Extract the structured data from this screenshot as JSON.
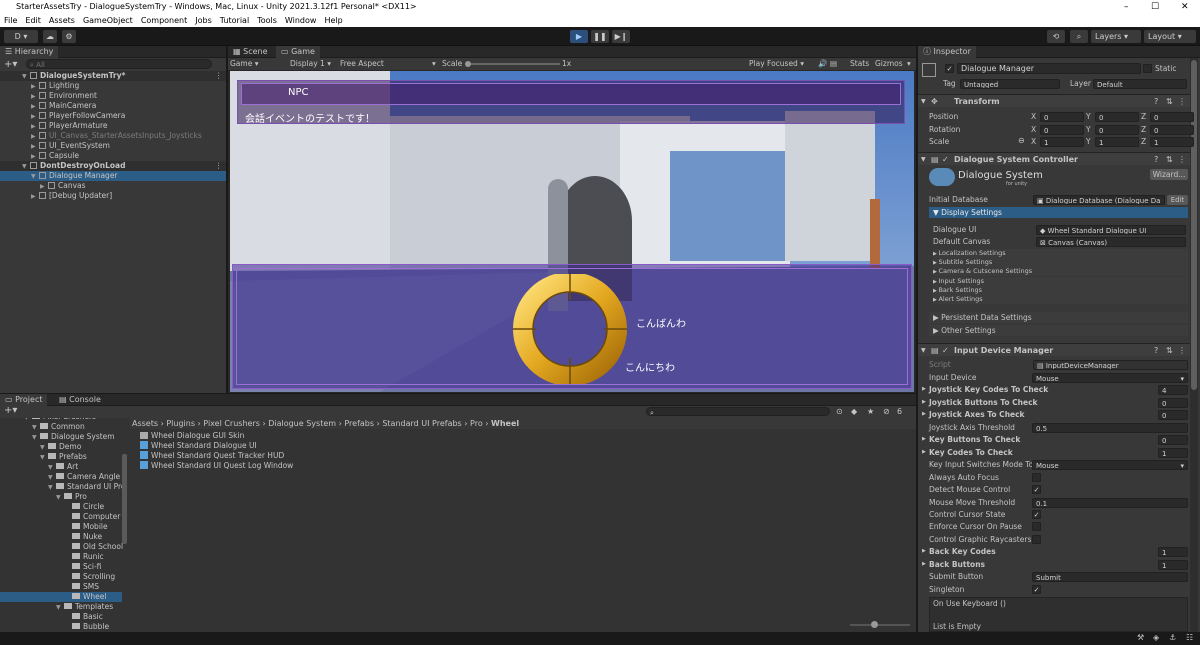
{
  "window": {
    "title": "StarterAssetsTry - DialogueSystemTry - Windows, Mac, Linux - Unity 2021.3.12f1 Personal* <DX11>",
    "minimize": "–",
    "maximize": "☐",
    "close": "✕"
  },
  "menu": [
    "File",
    "Edit",
    "Assets",
    "GameObject",
    "Component",
    "Jobs",
    "Tutorial",
    "Tools",
    "Window",
    "Help"
  ],
  "toolbar": {
    "account": "D ▾",
    "layers": "Layers",
    "layout": "Layout"
  },
  "hierarchy": {
    "tab": "Hierarchy",
    "search_placeholder": "All",
    "items": [
      {
        "label": "DialogueSystemTry*",
        "indent": 0,
        "kind": "scene"
      },
      {
        "label": "Lighting",
        "indent": 1,
        "kind": "obj"
      },
      {
        "label": "Environment",
        "indent": 1,
        "kind": "obj"
      },
      {
        "label": "MainCamera",
        "indent": 1,
        "kind": "obj"
      },
      {
        "label": "PlayerFollowCamera",
        "indent": 1,
        "kind": "obj"
      },
      {
        "label": "PlayerArmature",
        "indent": 1,
        "kind": "obj"
      },
      {
        "label": "UI_Canvas_StarterAssetsInputs_Joysticks",
        "indent": 1,
        "kind": "obj",
        "dim": true
      },
      {
        "label": "UI_EventSystem",
        "indent": 1,
        "kind": "obj"
      },
      {
        "label": "Capsule",
        "indent": 1,
        "kind": "obj"
      },
      {
        "label": "DontDestroyOnLoad",
        "indent": 0,
        "kind": "scene"
      },
      {
        "label": "Dialogue Manager",
        "indent": 1,
        "kind": "obj",
        "selected": true
      },
      {
        "label": "Canvas",
        "indent": 2,
        "kind": "obj"
      },
      {
        "label": "[Debug Updater]",
        "indent": 1,
        "kind": "obj"
      }
    ]
  },
  "scene_game": {
    "tabs": [
      "Scene",
      "Game"
    ],
    "game_label": "Game",
    "display": "Display 1",
    "aspect": "Free Aspect",
    "scale_label": "Scale",
    "scale_value": "1x",
    "play_focused": "Play Focused",
    "stats": "Stats",
    "gizmos": "Gizmos",
    "npc_name": "NPC",
    "npc_line": "会話イベントのテストです！",
    "response_1": "こんばんわ",
    "response_2": "こんにちわ"
  },
  "project": {
    "tabs": [
      "Project",
      "Console"
    ],
    "breadcrumb": [
      "Assets",
      "Plugins",
      "Pixel Crushers",
      "Dialogue System",
      "Prefabs",
      "Standard UI Prefabs",
      "Pro",
      "Wheel"
    ],
    "tree": [
      {
        "label": "Pixel Crushers",
        "indent": 0
      },
      {
        "label": "Common",
        "indent": 1
      },
      {
        "label": "Dialogue System",
        "indent": 1
      },
      {
        "label": "Demo",
        "indent": 2
      },
      {
        "label": "Prefabs",
        "indent": 2
      },
      {
        "label": "Art",
        "indent": 3
      },
      {
        "label": "Camera Angle S",
        "indent": 3
      },
      {
        "label": "Standard UI Pre",
        "indent": 3
      },
      {
        "label": "Pro",
        "indent": 4
      },
      {
        "label": "Circle",
        "indent": 5
      },
      {
        "label": "Computer",
        "indent": 5
      },
      {
        "label": "Mobile",
        "indent": 5
      },
      {
        "label": "Nuke",
        "indent": 5
      },
      {
        "label": "Old School",
        "indent": 5
      },
      {
        "label": "Runic",
        "indent": 5
      },
      {
        "label": "Sci-fi",
        "indent": 5
      },
      {
        "label": "Scrolling",
        "indent": 5
      },
      {
        "label": "SMS",
        "indent": 5
      },
      {
        "label": "Wheel",
        "indent": 5,
        "selected": true
      },
      {
        "label": "Templates",
        "indent": 4
      },
      {
        "label": "Basic",
        "indent": 5
      },
      {
        "label": "Bubble",
        "indent": 5
      }
    ],
    "files": [
      "Wheel Dialogue GUI Skin",
      "Wheel Standard Dialogue UI",
      "Wheel Standard Quest Tracker HUD",
      "Wheel Standard UI Quest Log Window"
    ],
    "count": "6"
  },
  "inspector": {
    "tab": "Inspector",
    "object_name": "Dialogue Manager",
    "static": "Static",
    "tag_label": "Tag",
    "tag": "Untagged",
    "layer_label": "Layer",
    "layer": "Default",
    "transform": {
      "title": "Transform",
      "rows": [
        {
          "label": "Position",
          "x": "0",
          "y": "0",
          "z": "0"
        },
        {
          "label": "Rotation",
          "x": "0",
          "y": "0",
          "z": "0"
        },
        {
          "label": "Scale",
          "x": "1",
          "y": "1",
          "z": "1"
        }
      ]
    },
    "dsc": {
      "title": "Dialogue System Controller",
      "logo_main": "Dialogue System",
      "logo_sub": "for unity",
      "wizard": "Wizard...",
      "initial_db_label": "Initial Database",
      "initial_db": "Dialogue Database (Dialogue Da",
      "edit": "Edit",
      "display_settings": "Display Settings",
      "dialogue_ui_label": "Dialogue UI",
      "dialogue_ui": "Wheel Standard Dialogue UI",
      "default_canvas_label": "Default Canvas",
      "default_canvas": "Canvas (Canvas)",
      "subsections": [
        "Localization Settings",
        "Subtitle Settings",
        "Camera & Cutscene Settings",
        "Input Settings",
        "Bark Settings",
        "Alert Settings"
      ],
      "persistent": "Persistent Data Settings",
      "other": "Other Settings"
    },
    "idm": {
      "title": "Input Device Manager",
      "script_label": "Script",
      "script": "InputDeviceManager",
      "rows": [
        {
          "label": "Input Device",
          "value": "Mouse",
          "type": "dropdown"
        },
        {
          "label": "Joystick Key Codes To Check",
          "value": "4",
          "type": "num",
          "bold": true
        },
        {
          "label": "Joystick Buttons To Check",
          "value": "0",
          "type": "num",
          "bold": true
        },
        {
          "label": "Joystick Axes To Check",
          "value": "0",
          "type": "num",
          "bold": true
        },
        {
          "label": "Joystick Axis Threshold",
          "value": "0.5",
          "type": "field"
        },
        {
          "label": "Key Buttons To Check",
          "value": "0",
          "type": "num",
          "bold": true
        },
        {
          "label": "Key Codes To Check",
          "value": "1",
          "type": "num",
          "bold": true
        },
        {
          "label": "Key Input Switches Mode To",
          "value": "Mouse",
          "type": "dropdown"
        },
        {
          "label": "Always Auto Focus",
          "value": "",
          "type": "check"
        },
        {
          "label": "Detect Mouse Control",
          "value": "✓",
          "type": "check"
        },
        {
          "label": "Mouse Move Threshold",
          "value": "0.1",
          "type": "field"
        },
        {
          "label": "Control Cursor State",
          "value": "✓",
          "type": "check"
        },
        {
          "label": "Enforce Cursor On Pause",
          "value": "",
          "type": "check"
        },
        {
          "label": "Control Graphic Raycasters",
          "value": "",
          "type": "check"
        },
        {
          "label": "Back Key Codes",
          "value": "1",
          "type": "num",
          "bold": true
        },
        {
          "label": "Back Buttons",
          "value": "1",
          "type": "num",
          "bold": true
        },
        {
          "label": "Submit Button",
          "value": "Submit",
          "type": "field"
        },
        {
          "label": "Singleton",
          "value": "✓",
          "type": "check"
        }
      ],
      "on_use": "On Use Keyboard ()",
      "list_empty": "List is Empty"
    }
  }
}
